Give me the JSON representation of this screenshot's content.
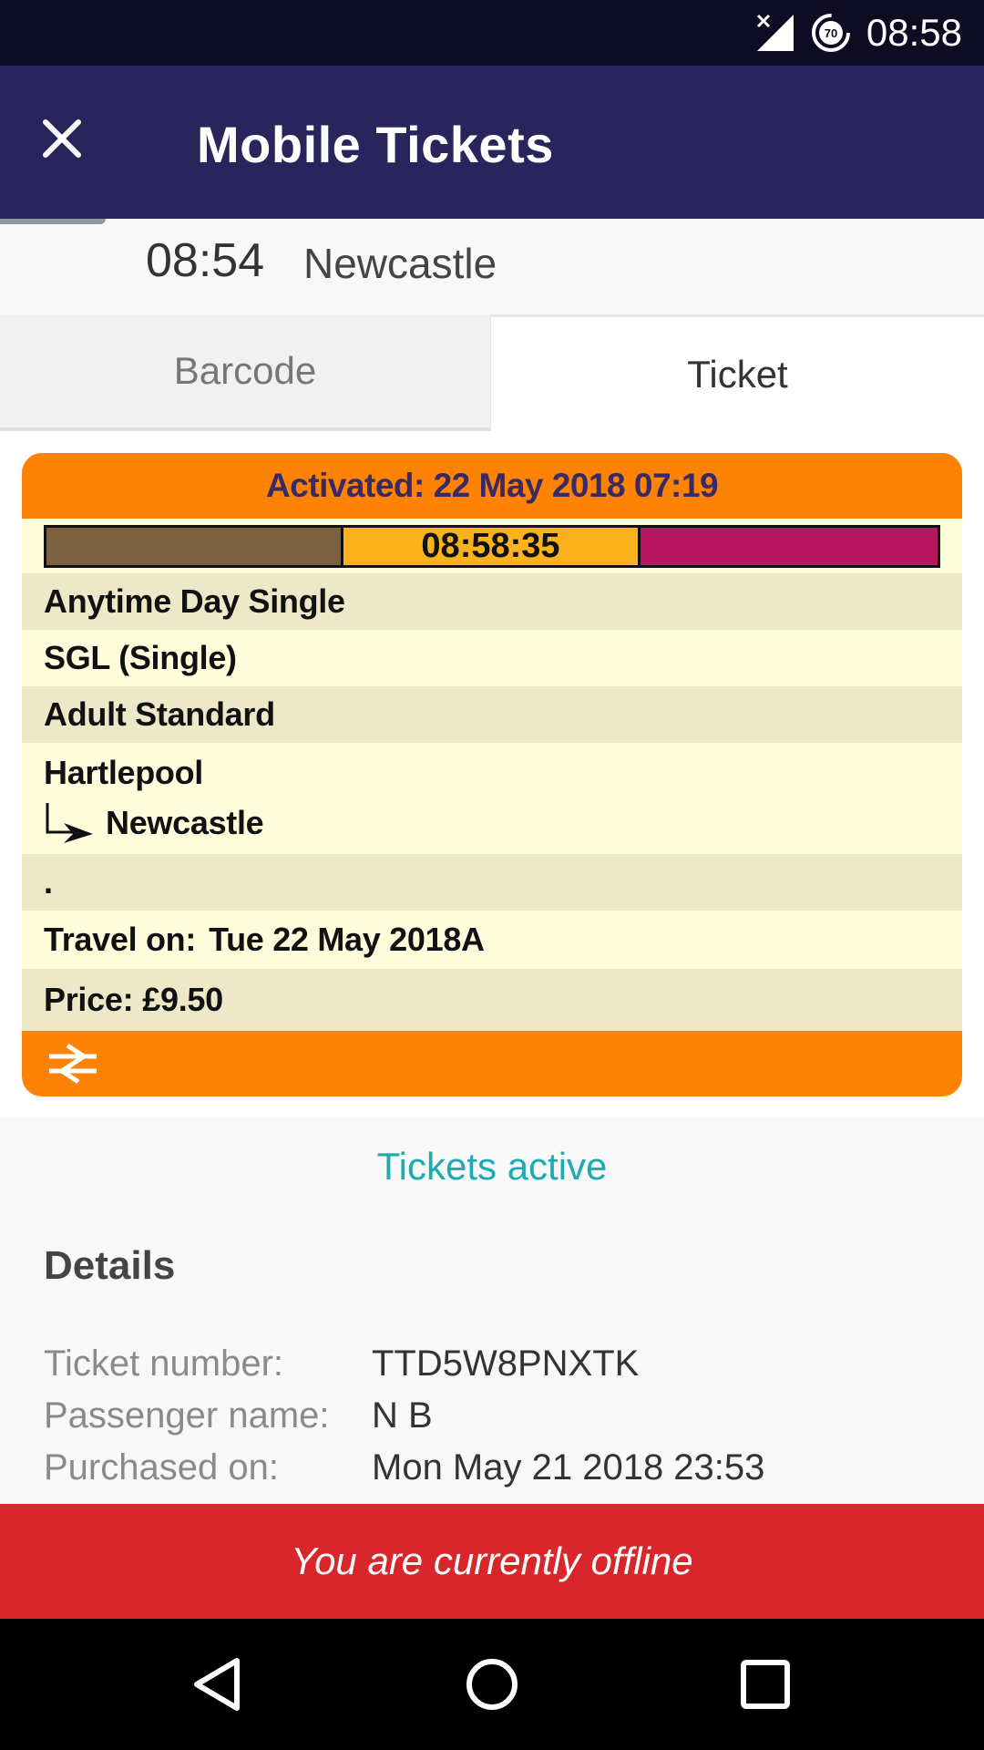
{
  "status_bar": {
    "time": "08:58",
    "battery_level": "70",
    "icons": [
      "signal-off-icon",
      "battery-saver-icon"
    ]
  },
  "app_bar": {
    "title": "Mobile Tickets",
    "close_icon": "close-icon"
  },
  "journey": {
    "time": "08:54",
    "destination": "Newcastle"
  },
  "tabs": [
    {
      "label": "Barcode",
      "selected": false
    },
    {
      "label": "Ticket",
      "selected": true
    }
  ],
  "ticket": {
    "activated": "Activated: 22 May 2018 07:19",
    "timer": "08:58:35",
    "timer_colors": [
      "#7c6140",
      "#fbb21c",
      "#b8175f"
    ],
    "ticket_type": "Anytime Day Single",
    "journey_type": "SGL (Single)",
    "passenger_class": "Adult Standard",
    "origin": "Hartlepool",
    "destination": "Newcastle",
    "notes": ".",
    "travel_on_label": "Travel on:",
    "travel_on_value": "Tue 22 May 2018A",
    "price_label": "Price:",
    "price_value": "£9.50",
    "logo_icon": "national-rail-icon",
    "accent_color": "#fe8203"
  },
  "status": {
    "active_text": "Tickets active"
  },
  "details": {
    "title": "Details",
    "rows": [
      {
        "label": "Ticket number:",
        "value": "TTD5W8PNXTK"
      },
      {
        "label": "Passenger name:",
        "value": "N B"
      },
      {
        "label": "Purchased on:",
        "value": "Mon May 21 2018 23:53"
      }
    ]
  },
  "offline_banner": {
    "text": "You are currently offline",
    "color": "#d9262b"
  },
  "nav_bar": {
    "icons": [
      "back-icon",
      "home-icon",
      "recents-icon"
    ]
  }
}
